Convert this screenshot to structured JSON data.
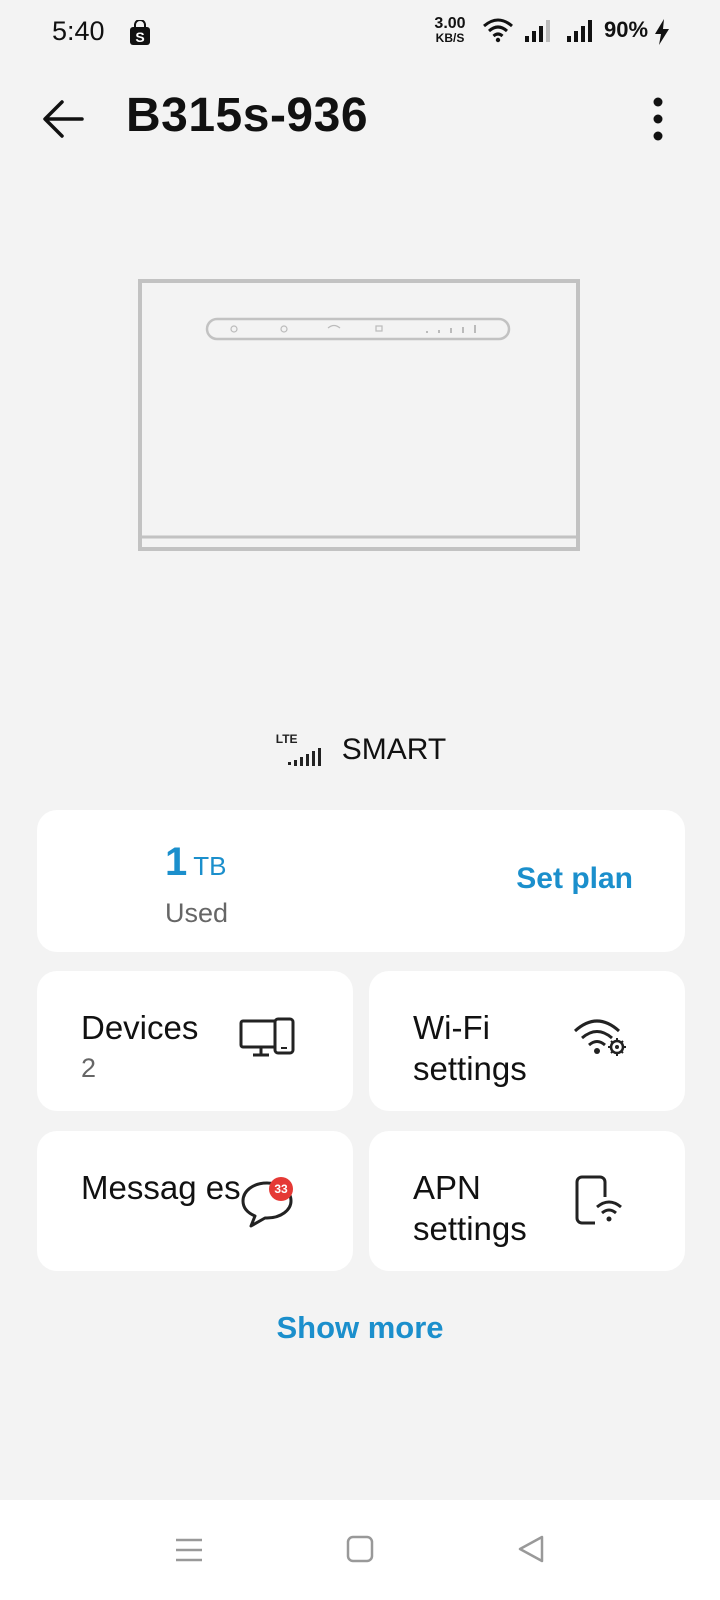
{
  "status_bar": {
    "time": "5:40",
    "speed_value": "3.00",
    "speed_unit": "KB/S",
    "battery": "90%",
    "icons": [
      "shopping-bag-icon",
      "wifi-icon",
      "signal-icon",
      "signal-icon",
      "charging-bolt-icon"
    ]
  },
  "header": {
    "title": "B315s-936",
    "back_icon": "arrow-left-icon",
    "menu_icon": "more-vertical-icon"
  },
  "network": {
    "tech": "LTE",
    "operator": "SMART"
  },
  "plan": {
    "amount": "1",
    "unit": "TB",
    "used_label": "Used",
    "action": "Set plan"
  },
  "tiles": {
    "devices": {
      "label": "Devices",
      "count": "2",
      "icon": "devices-icon"
    },
    "wifi": {
      "label": "Wi-Fi settings",
      "icon": "wifi-settings-icon"
    },
    "messages": {
      "label": "Messag es",
      "badge": "33",
      "icon": "message-bubble-icon"
    },
    "apn": {
      "label": "APN settings",
      "icon": "phone-wifi-icon"
    }
  },
  "show_more": "Show more",
  "colors": {
    "accent": "#1b8fcc",
    "badge": "#e53935",
    "background": "#f3f3f3"
  }
}
